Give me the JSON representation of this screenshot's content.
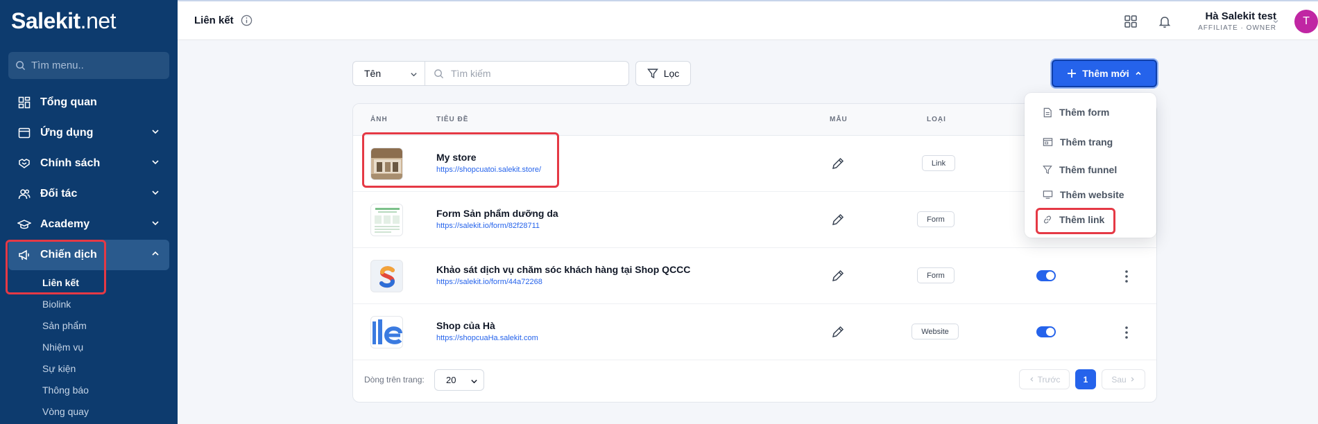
{
  "brand": {
    "name": "Salekit",
    "suffix": ".net"
  },
  "sidebar": {
    "search_placeholder": "Tìm menu..",
    "items": [
      {
        "label": "Tổng quan",
        "icon": "dashboard-icon",
        "has_children": false
      },
      {
        "label": "Ứng dụng",
        "icon": "browser-icon",
        "has_children": true
      },
      {
        "label": "Chính sách",
        "icon": "handshake-icon",
        "has_children": true
      },
      {
        "label": "Đối tác",
        "icon": "users-icon",
        "has_children": true
      },
      {
        "label": "Academy",
        "icon": "graduation-cap-icon",
        "has_children": true
      },
      {
        "label": "Chiến dịch",
        "icon": "megaphone-icon",
        "has_children": true,
        "expanded": true
      }
    ],
    "subitems": [
      "Liên kết",
      "Biolink",
      "Sản phẩm",
      "Nhiệm vụ",
      "Sự kiện",
      "Thông báo",
      "Vòng quay"
    ],
    "active_subitem": "Liên kết"
  },
  "header": {
    "title": "Liên kết",
    "user_name": "Hà Salekit test",
    "user_role": "AFFILIATE · OWNER",
    "avatar_letter": "T",
    "avatar_color": "#c026a3"
  },
  "toolbar": {
    "field_select": "Tên",
    "search_placeholder": "Tìm kiếm",
    "filter_label": "Lọc",
    "add_label": "Thêm mới"
  },
  "table": {
    "columns": {
      "image": "ẢNH",
      "title": "TIÊU ĐỀ",
      "template": "MẪU",
      "type": "LOẠI"
    },
    "rows": [
      {
        "title": "My store",
        "url": "https://shopcuatoi.salekit.store/",
        "type": "Link",
        "has_toggle": false
      },
      {
        "title": "Form Sản phẩm dưỡng da",
        "url": "https://salekit.io/form/82f28711",
        "type": "Form",
        "has_toggle": false
      },
      {
        "title": "Khảo sát dịch vụ chăm sóc khách hàng tại Shop QCCC",
        "url": "https://salekit.io/form/44a72268",
        "type": "Form",
        "has_toggle": true
      },
      {
        "title": "Shop của Hà",
        "url": "https://shopcuaHa.salekit.com",
        "type": "Website",
        "has_toggle": true
      }
    ]
  },
  "pagination": {
    "rows_label": "Dòng trên trang:",
    "rows_per_page": "20",
    "prev_label": "Trước",
    "next_label": "Sau",
    "current_page": "1"
  },
  "dropdown": {
    "items": [
      {
        "label": "Thêm form",
        "icon": "file-icon"
      },
      {
        "label": "Thêm trang",
        "icon": "page-icon"
      },
      {
        "label": "Thêm funnel",
        "icon": "funnel-icon"
      },
      {
        "label": "Thêm website",
        "icon": "monitor-icon"
      },
      {
        "label": "Thêm link",
        "icon": "link-icon"
      }
    ]
  },
  "colors": {
    "sidebar": "#0d3b6e",
    "accent": "#2563eb",
    "highlight": "#e53945"
  }
}
